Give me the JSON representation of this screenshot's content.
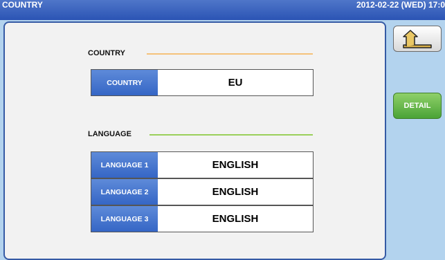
{
  "titlebar": {
    "title": "COUNTRY",
    "datetime": "2012-02-22 (WED) 17:0"
  },
  "country_section": {
    "heading": "COUNTRY",
    "line_color": "#f5c27a",
    "row": {
      "label": "COUNTRY",
      "value": "EU"
    }
  },
  "language_section": {
    "heading": "LANGUAGE",
    "line_color": "#9ad05a",
    "rows": [
      {
        "label": "LANGUAGE 1",
        "value": "ENGLISH"
      },
      {
        "label": "LANGUAGE 2",
        "value": "ENGLISH"
      },
      {
        "label": "LANGUAGE 3",
        "value": "ENGLISH"
      }
    ]
  },
  "side": {
    "back_icon": "return-arrow-icon",
    "detail_label": "DETAIL"
  },
  "colors": {
    "title_bar": "#2f5bb8",
    "label_blue": "#3d6ecb",
    "detail_green": "#5ab33e",
    "background": "#b3d3ee"
  }
}
